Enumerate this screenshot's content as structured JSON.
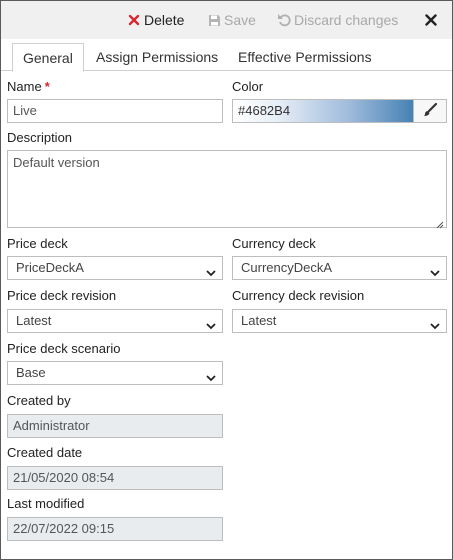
{
  "toolbar": {
    "delete_label": "Delete",
    "save_label": "Save",
    "discard_label": "Discard changes"
  },
  "tabs": [
    {
      "label": "General",
      "active": true
    },
    {
      "label": "Assign Permissions",
      "active": false
    },
    {
      "label": "Effective Permissions",
      "active": false
    }
  ],
  "form": {
    "name": {
      "label": "Name",
      "required_mark": "*",
      "value": "Live"
    },
    "color": {
      "label": "Color",
      "value": "#4682B4"
    },
    "description": {
      "label": "Description",
      "value": "Default version"
    },
    "price_deck": {
      "label": "Price deck",
      "value": "PriceDeckA"
    },
    "currency_deck": {
      "label": "Currency deck",
      "value": "CurrencyDeckA"
    },
    "price_deck_revision": {
      "label": "Price deck revision",
      "value": "Latest"
    },
    "currency_deck_revision": {
      "label": "Currency deck revision",
      "value": "Latest"
    },
    "price_deck_scenario": {
      "label": "Price deck scenario",
      "value": "Base"
    },
    "created_by": {
      "label": "Created by",
      "value": "Administrator"
    },
    "created_date": {
      "label": "Created date",
      "value": "21/05/2020 08:54"
    },
    "last_modified": {
      "label": "Last modified",
      "value": "22/07/2022 09:15"
    }
  },
  "colors": {
    "delete_icon": "#d9262f",
    "disabled_text": "#a8a8a8",
    "swatch": "#4682B4"
  },
  "icons": {
    "delete": "x-icon",
    "save": "floppy-icon",
    "discard": "undo-icon",
    "close": "close-icon",
    "color_picker": "brush-icon",
    "dropdown": "chevron-down-icon"
  }
}
